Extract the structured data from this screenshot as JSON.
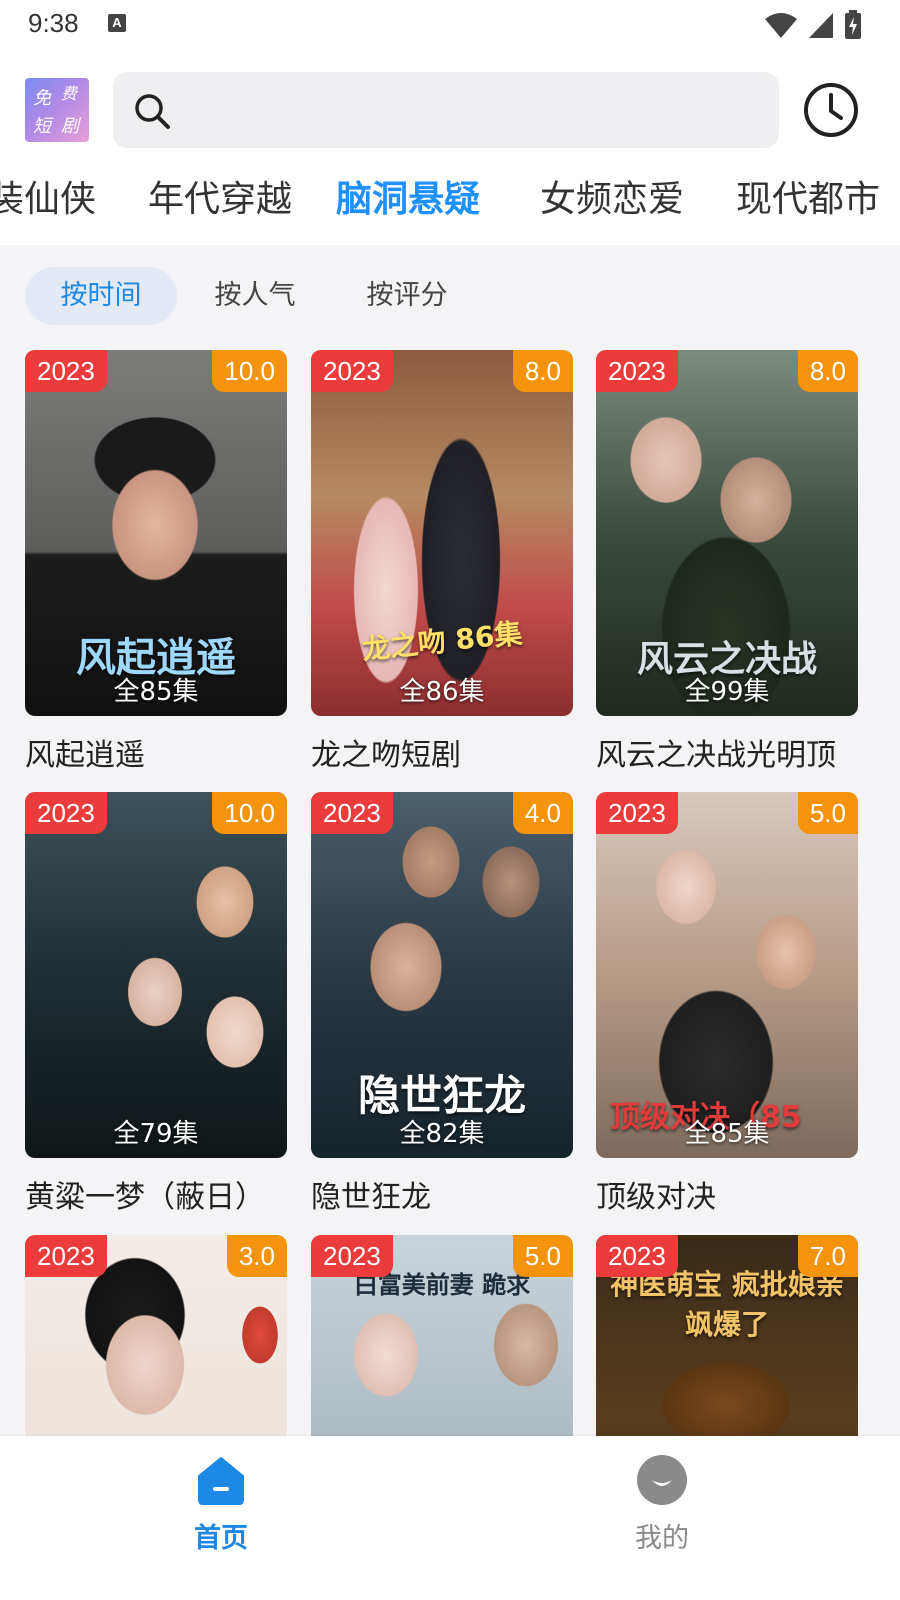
{
  "status_bar": {
    "time": "9:38",
    "notification_letter": "A"
  },
  "app": {
    "logo_chars": [
      "免",
      "费",
      "短",
      "剧"
    ]
  },
  "search": {
    "placeholder": ""
  },
  "categories": [
    "装仙侠",
    "年代穿越",
    "脑洞悬疑",
    "女频恋爱",
    "现代都市"
  ],
  "active_category": "脑洞悬疑",
  "sort_options": [
    "按时间",
    "按人气",
    "按评分"
  ],
  "active_sort": "按时间",
  "dramas": [
    {
      "year": "2023",
      "score": "10.0",
      "episodes": "全85集",
      "title": "风起逍遥",
      "poster_text": "风起逍遥"
    },
    {
      "year": "2023",
      "score": "8.0",
      "episodes": "全86集",
      "title": "龙之吻短剧",
      "poster_text": "龙之吻 86集"
    },
    {
      "year": "2023",
      "score": "8.0",
      "episodes": "全99集",
      "title": "风云之决战光明顶",
      "poster_text": "风云之决战"
    },
    {
      "year": "2023",
      "score": "10.0",
      "episodes": "全79集",
      "title": "黄粱一梦（蔽日）",
      "poster_text": ""
    },
    {
      "year": "2023",
      "score": "4.0",
      "episodes": "全82集",
      "title": "隐世狂龙",
      "poster_text": "隐世狂龙"
    },
    {
      "year": "2023",
      "score": "5.0",
      "episodes": "全85集",
      "title": "顶级对决",
      "poster_text": "顶级对决（85"
    },
    {
      "year": "2023",
      "score": "3.0",
      "episodes": "",
      "title": "",
      "poster_text": ""
    },
    {
      "year": "2023",
      "score": "5.0",
      "episodes": "",
      "title": "",
      "poster_text": "白富美前妻 跪求"
    },
    {
      "year": "2023",
      "score": "7.0",
      "episodes": "",
      "title": "",
      "poster_text": "神医萌宝 疯批娘亲飒爆了"
    }
  ],
  "bottom_nav": [
    {
      "label": "首页",
      "icon": "home-icon",
      "active": true
    },
    {
      "label": "我的",
      "icon": "profile-icon",
      "active": false
    }
  ],
  "colors": {
    "accent": "#1e88e5",
    "year_badge": "#ec3b3b",
    "score_badge": "#f3940c",
    "inactive_nav": "#9a9a9a"
  }
}
